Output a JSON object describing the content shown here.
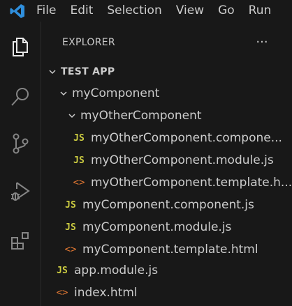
{
  "menubar": {
    "logo_icon": "vscode-logo-icon",
    "items": [
      "File",
      "Edit",
      "Selection",
      "View",
      "Go",
      "Run"
    ]
  },
  "activity_bar": {
    "icons": [
      "explorer-icon",
      "search-icon",
      "source-control-icon",
      "run-debug-icon",
      "extensions-icon"
    ]
  },
  "explorer": {
    "title": "EXPLORER",
    "more_label": "···",
    "root": "TEST APP",
    "tree": [
      {
        "type": "folder",
        "label": "myComponent"
      },
      {
        "type": "folder",
        "label": "myOtherComponent"
      },
      {
        "type": "js",
        "label": "myOtherComponent.compone..."
      },
      {
        "type": "js",
        "label": "myOtherComponent.module.js"
      },
      {
        "type": "html",
        "label": "myOtherComponent.template.h..."
      },
      {
        "type": "js",
        "label": "myComponent.component.js"
      },
      {
        "type": "js",
        "label": "myComponent.module.js"
      },
      {
        "type": "html",
        "label": "myComponent.template.html"
      },
      {
        "type": "js",
        "label": "app.module.js"
      },
      {
        "type": "html",
        "label": "index.html"
      }
    ],
    "js_badge": "JS",
    "html_badge": "<>"
  },
  "colors": {
    "background": "#181818",
    "text": "#cccccc",
    "js_icon": "#cbcb41",
    "html_icon": "#e37933",
    "logo": "#2f8fdd"
  }
}
